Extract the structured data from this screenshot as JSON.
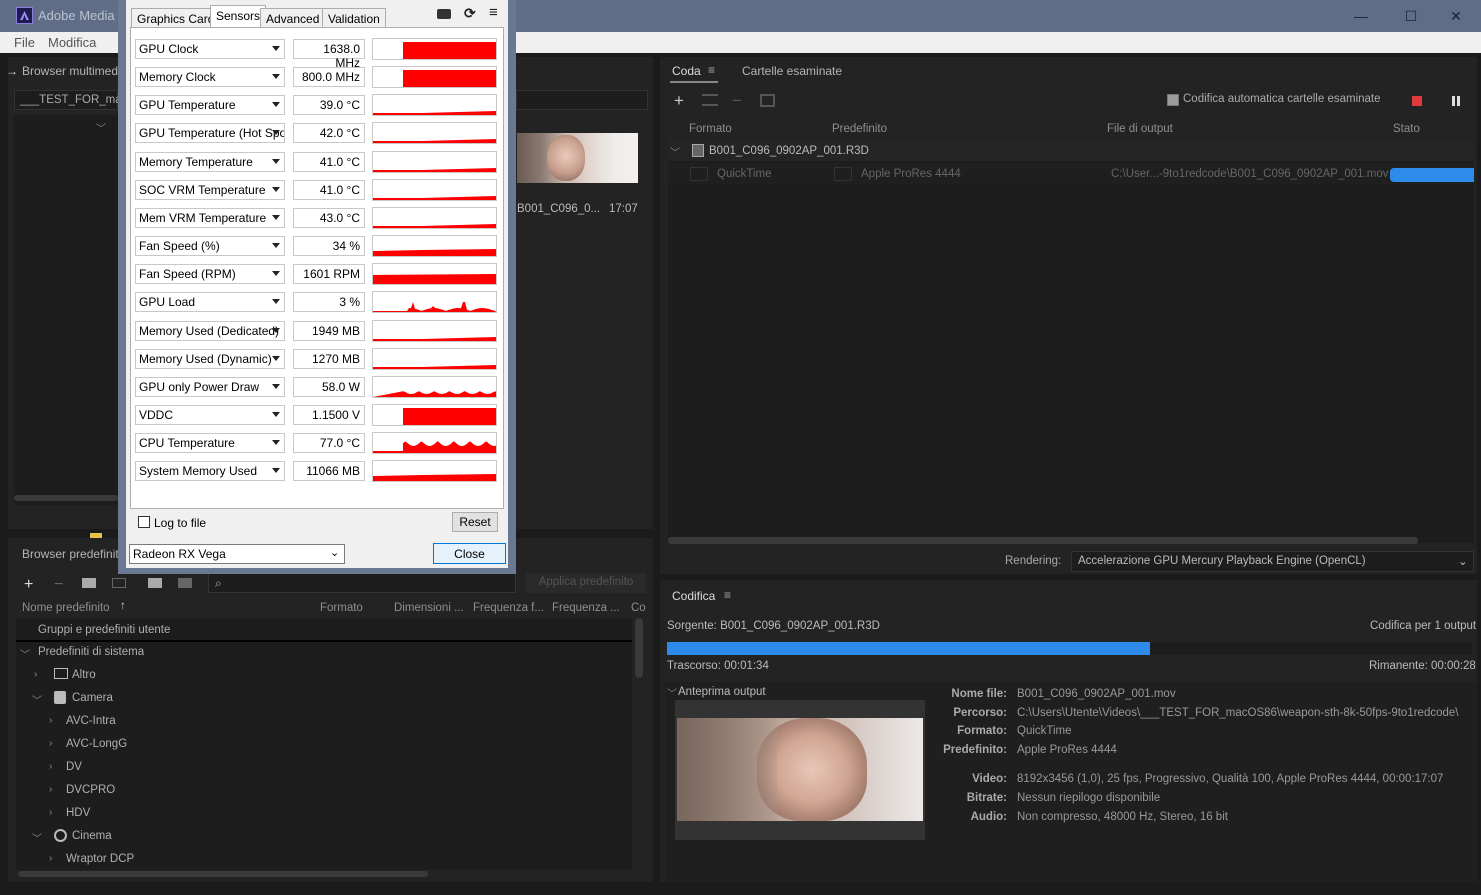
{
  "window": {
    "title": "Adobe Media"
  },
  "menu": [
    "File",
    "Modifica"
  ],
  "media_browser": {
    "title": "Browser multimedia",
    "path": "___TEST_FOR_mac",
    "thumb_name": "B001_C096_0...",
    "thumb_duration": "17:07"
  },
  "presets_panel": {
    "title": "Browser predefiniti",
    "apply_button": "Applica predefinito",
    "columns": [
      "Nome predefinito",
      "Formato",
      "Dimensioni ...",
      "Frequenza f...",
      "Frequenza ...",
      "Co"
    ],
    "groups": [
      {
        "label": "Gruppi e predefiniti utente"
      },
      {
        "label": "Predefiniti di sistema"
      }
    ],
    "items": [
      {
        "label": "Altro",
        "icon": "monitor-icon"
      },
      {
        "label": "Camera",
        "icon": "camera-icon"
      },
      {
        "label": "AVC-Intra"
      },
      {
        "label": "AVC-LongG"
      },
      {
        "label": "DV"
      },
      {
        "label": "DVCPRO"
      },
      {
        "label": "HDV"
      },
      {
        "label": "Cinema",
        "icon": "film-reel-icon"
      },
      {
        "label": "Wraptor DCP"
      }
    ]
  },
  "queue": {
    "tabs": [
      "Coda",
      "Cartelle esaminate"
    ],
    "auto_encode_label": "Codifica automatica cartelle esaminate",
    "columns": [
      "Formato",
      "Predefinito",
      "File di output",
      "Stato"
    ],
    "source_file": "B001_C096_0902AP_001.R3D",
    "output": {
      "format": "QuickTime",
      "preset": "Apple ProRes 4444",
      "file": "C:\\User...-9to1redcode\\B001_C096_0902AP_001.mov"
    },
    "rendering_label": "Rendering:",
    "rendering_value": "Accelerazione GPU Mercury Playback Engine (OpenCL)"
  },
  "encoding": {
    "title": "Codifica",
    "source": "Sorgente: B001_C096_0902AP_001.R3D",
    "count": "Codifica per 1 output",
    "progress": 0.6,
    "elapsed": "Trascorso: 00:01:34",
    "remaining": "Rimanente: 00:00:28",
    "preview_title": "Anteprima output",
    "info": [
      {
        "k": "Nome file:",
        "v": "B001_C096_0902AP_001.mov"
      },
      {
        "k": "Percorso:",
        "v": "C:\\Users\\Utente\\Videos\\___TEST_FOR_macOS86\\weapon-sth-8k-50fps-9to1redcode\\"
      },
      {
        "k": "Formato:",
        "v": "QuickTime"
      },
      {
        "k": "Predefinito:",
        "v": "Apple ProRes 4444"
      },
      {
        "k": "Video:",
        "v": "8192x3456 (1,0), 25 fps, Progressivo, Qualità 100, Apple ProRes 4444, 00:00:17:07"
      },
      {
        "k": "Bitrate:",
        "v": "Nessun riepilogo disponibile"
      },
      {
        "k": "Audio:",
        "v": "Non compresso, 48000 Hz, Stereo, 16 bit"
      }
    ]
  },
  "gpuz": {
    "tabs": [
      "Graphics Card",
      "Sensors",
      "Advanced",
      "Validation"
    ],
    "sensors": [
      {
        "name": "GPU Clock",
        "value": "1638.0 MHz",
        "graph": "full"
      },
      {
        "name": "Memory Clock",
        "value": "800.0 MHz",
        "graph": "full"
      },
      {
        "name": "GPU Temperature",
        "value": "39.0 °C",
        "graph": "low"
      },
      {
        "name": "GPU Temperature (Hot Spot)",
        "value": "42.0 °C",
        "graph": "low"
      },
      {
        "name": "Memory Temperature",
        "value": "41.0 °C",
        "graph": "low"
      },
      {
        "name": "SOC VRM Temperature",
        "value": "41.0 °C",
        "graph": "low"
      },
      {
        "name": "Mem VRM Temperature",
        "value": "43.0 °C",
        "graph": "low"
      },
      {
        "name": "Fan Speed (%)",
        "value": "34 %",
        "graph": "mid"
      },
      {
        "name": "Fan Speed (RPM)",
        "value": "1601 RPM",
        "graph": "midhigh"
      },
      {
        "name": "GPU Load",
        "value": "3 %",
        "graph": "spiky"
      },
      {
        "name": "Memory Used (Dedicated)",
        "value": "1949 MB",
        "graph": "low"
      },
      {
        "name": "Memory Used (Dynamic)",
        "value": "1270 MB",
        "graph": "low"
      },
      {
        "name": "GPU only Power Draw",
        "value": "58.0 W",
        "graph": "noisy"
      },
      {
        "name": "VDDC",
        "value": "1.1500 V",
        "graph": "full"
      },
      {
        "name": "CPU Temperature",
        "value": "77.0 °C",
        "graph": "noisyhigh"
      },
      {
        "name": "System Memory Used",
        "value": "11066 MB",
        "graph": "mid"
      }
    ],
    "log_label": "Log to file",
    "reset_label": "Reset",
    "card": "Radeon RX Vega",
    "close_label": "Close"
  },
  "colors": {
    "accent_blue": "#2d8ceb",
    "graph_red": "#ff0000",
    "stop_red": "#e03a3a"
  }
}
